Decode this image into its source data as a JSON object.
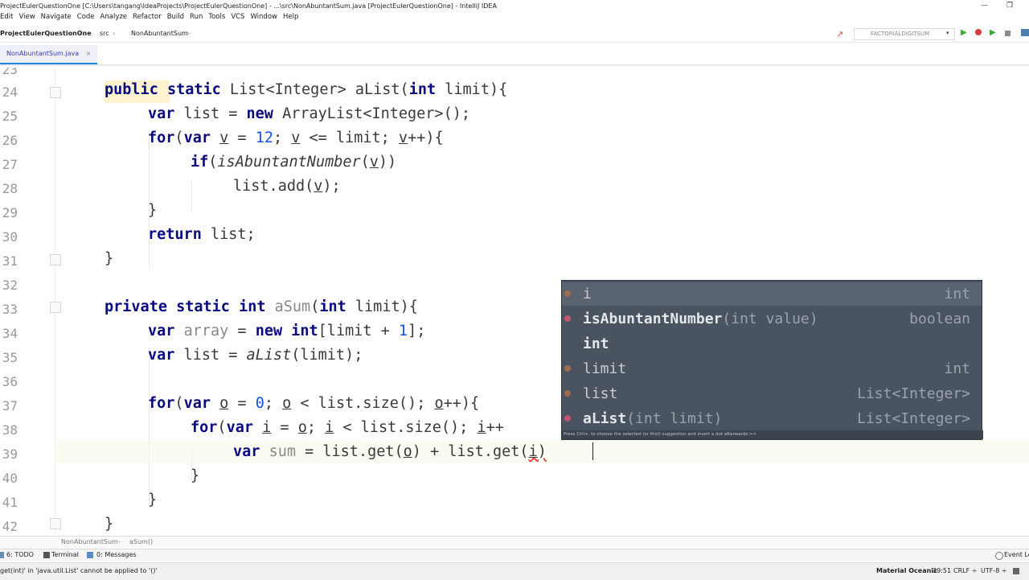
{
  "window": {
    "title": "ProjectEulerQuestionOne [C:\\Users\\tangang\\IdeaProjects\\ProjectEulerQuestionOne] - ...\\src\\NonAbuntantSum.java [ProjectEulerQuestionOne] - IntelliJ IDEA",
    "minimize": "—",
    "maximize": "❐"
  },
  "menu": [
    "Edit",
    "View",
    "Navigate",
    "Code",
    "Analyze",
    "Refactor",
    "Build",
    "Run",
    "Tools",
    "VCS",
    "Window",
    "Help"
  ],
  "navbar": {
    "project": "ProjectEulerQuestionOne",
    "src": "src",
    "file": "NonAbuntantSum",
    "run_config": "FACTORIALDIGITSUM"
  },
  "tab": {
    "label": "NonAbuntantSum.java",
    "close": "×"
  },
  "editor": {
    "line_numbers": [
      "23",
      "24",
      "25",
      "26",
      "27",
      "28",
      "29",
      "30",
      "31",
      "32",
      "33",
      "34",
      "35",
      "36",
      "37",
      "38",
      "39",
      "40",
      "41",
      "42"
    ]
  },
  "completion": {
    "items": [
      {
        "name": "i",
        "args": "",
        "type": "int"
      },
      {
        "name": "isAbuntantNumber",
        "args": "(int value)",
        "type": "boolean"
      },
      {
        "name": "int",
        "args": "",
        "type": ""
      },
      {
        "name": "limit",
        "args": "",
        "type": "int"
      },
      {
        "name": "list",
        "args": "",
        "type": "List<Integer>"
      },
      {
        "name": "aList",
        "args": "(int limit)",
        "type": "List<Integer>"
      }
    ],
    "hint": "Press Ctrl+. to choose the selected (or first) suggestion and insert a dot afterwards  >>"
  },
  "breadcrumbs": [
    "NonAbuntantSum",
    "aSum()"
  ],
  "toolwindows": [
    {
      "label": "6: TODO"
    },
    {
      "label": "Terminal"
    },
    {
      "label": "0: Messages"
    },
    {
      "label": "Event Log"
    }
  ],
  "status": {
    "message": "get(int)' in 'java.util.List' cannot be applied to '()'",
    "theme": "Material Oceanic",
    "position": "39:51",
    "line_sep": "CRLF ÷",
    "encoding": "UTF-8 ÷"
  }
}
